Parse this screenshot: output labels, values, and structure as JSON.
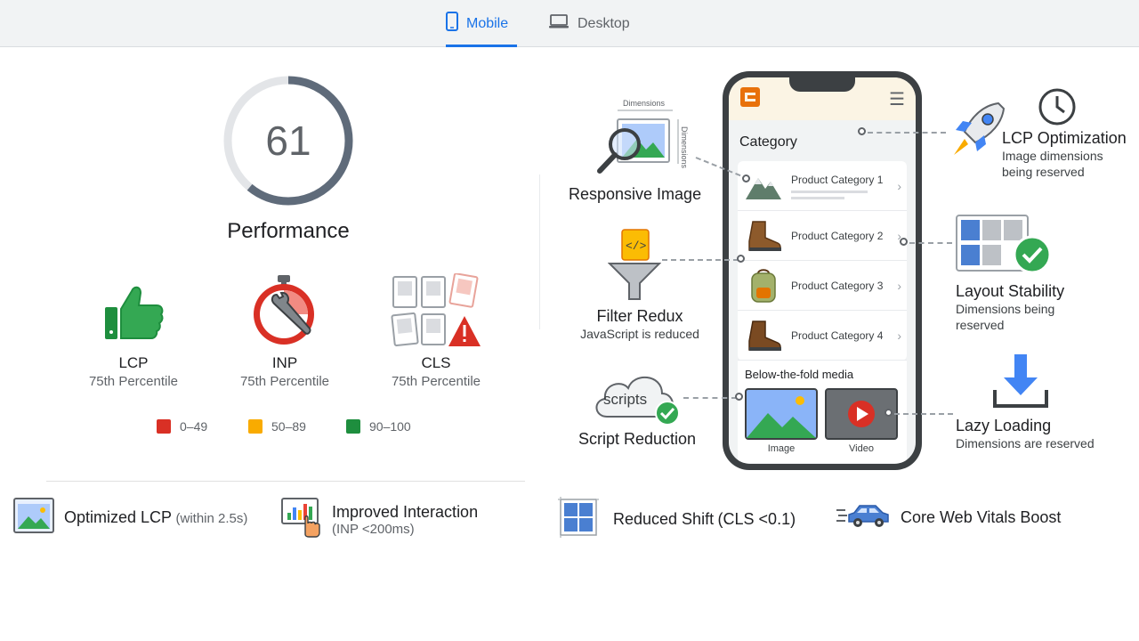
{
  "tabs": [
    {
      "label": "Mobile",
      "active": true,
      "icon": "phone-icon"
    },
    {
      "label": "Desktop",
      "active": false,
      "icon": "laptop-icon"
    }
  ],
  "score": {
    "value": "61",
    "label": "Performance",
    "fraction": 0.61
  },
  "metrics": [
    {
      "name": "LCP",
      "sub": "75th Percentile",
      "icon": "thumbs-up-icon"
    },
    {
      "name": "INP",
      "sub": "75th Percentile",
      "icon": "stopwatch-wrench-icon"
    },
    {
      "name": "CLS",
      "sub": "75th Percentile",
      "icon": "layout-shift-warning-icon"
    }
  ],
  "legend": [
    {
      "label": "0–49",
      "color": "#d93025"
    },
    {
      "label": "50–89",
      "color": "#f9ab00"
    },
    {
      "label": "90–100",
      "color": "#1e8e3e"
    }
  ],
  "features": [
    {
      "title": "Optimized LCP",
      "detail": "(within 2.5s)",
      "icon": "image-icon"
    },
    {
      "title": "Improved Interaction",
      "detail": "(INP <200ms)",
      "icon": "chart-click-icon"
    },
    {
      "title": "Reduced Shift",
      "detail": "(CLS <0.1)",
      "icon": "grid-icon"
    },
    {
      "title": "Core Web Vitals Boost",
      "detail": "",
      "icon": "fast-car-icon"
    }
  ],
  "phone": {
    "category_title": "Category",
    "categories": [
      "Product Category 1",
      "Product Category 2",
      "Product Category 3",
      "Product Category 4"
    ],
    "below_fold_title": "Below-the-fold media",
    "media": [
      "Image",
      "Video"
    ]
  },
  "callouts": {
    "responsive_image": {
      "title": "Responsive Image",
      "dim1": "Dimensions",
      "dim2": "Dimensions"
    },
    "filter_redux": {
      "title": "Filter Redux",
      "detail": "JavaScript is reduced",
      "badge": "</>"
    },
    "script_reduction": {
      "title": "Script Reduction",
      "badge": "scripts"
    },
    "lcp_optimization": {
      "title": "LCP Optimization",
      "detail1": "Image dimensions",
      "detail2": "being reserved"
    },
    "layout_stability": {
      "title": "Layout Stability",
      "detail1": "Dimensions being",
      "detail2": "reserved"
    },
    "lazy_loading": {
      "title": "Lazy Loading",
      "detail": "Dimensions are reserved"
    }
  }
}
